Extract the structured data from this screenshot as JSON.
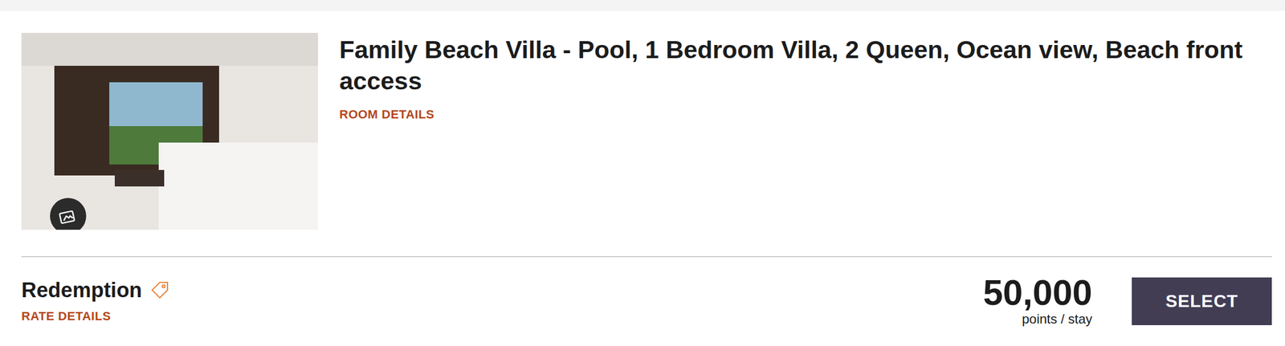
{
  "room": {
    "title": "Family Beach Villa - Pool, 1 Bedroom Villa, 2 Queen, Ocean view, Beach front access",
    "room_details": "ROOM DETAILS"
  },
  "rate": {
    "name": "Redemption",
    "rate_details": "RATE DETAILS",
    "price": "50,000",
    "unit": "points / stay",
    "button": "SELECT"
  }
}
